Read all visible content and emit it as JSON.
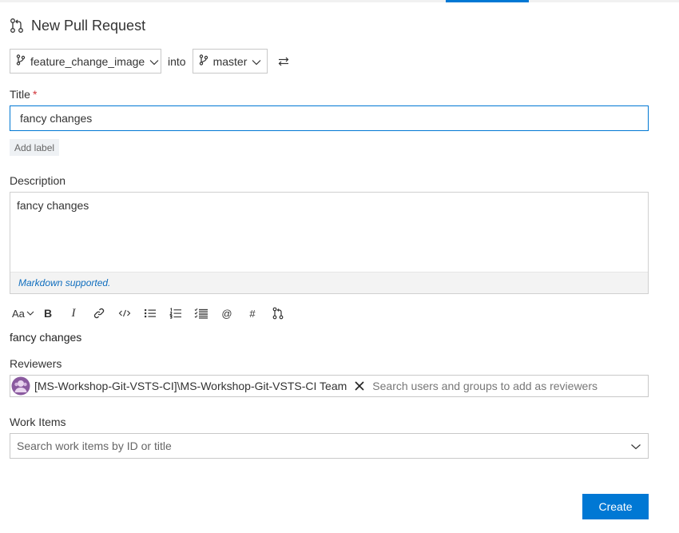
{
  "header": {
    "title": "New Pull Request"
  },
  "branches": {
    "source": "feature_change_image",
    "into_label": "into",
    "target": "master"
  },
  "title_field": {
    "label": "Title",
    "required_mark": "*",
    "value": "fancy changes"
  },
  "add_label": "Add label",
  "description": {
    "label": "Description",
    "value": "fancy changes",
    "markdown_note": "Markdown supported."
  },
  "toolbar": {
    "font_size_label": "Aa",
    "bold_label": "B",
    "italic_label": "I",
    "mention_label": "@",
    "workitem_label": "#"
  },
  "preview_text": "fancy changes",
  "reviewers": {
    "label": "Reviewers",
    "chips": [
      {
        "name": "[MS-Workshop-Git-VSTS-CI]\\MS-Workshop-Git-VSTS-CI Team"
      }
    ],
    "placeholder": "Search users and groups to add as reviewers"
  },
  "work_items": {
    "label": "Work Items",
    "placeholder": "Search work items by ID or title"
  },
  "create_label": "Create",
  "colors": {
    "accent": "#0078d4",
    "required": "#d13438",
    "avatar": "#8a5a9f"
  }
}
